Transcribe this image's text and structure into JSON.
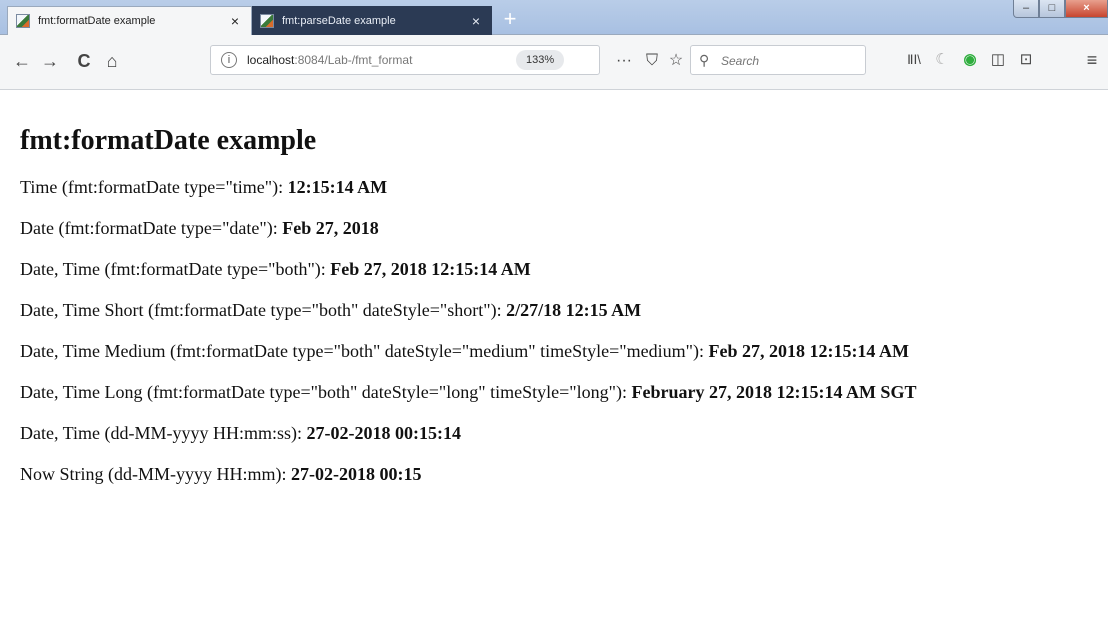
{
  "browser": {
    "tabs": [
      {
        "title": "fmt:formatDate example",
        "close": "×",
        "active": true
      },
      {
        "title": "fmt:parseDate example",
        "close": "×",
        "active": false
      }
    ],
    "new_tab": "+",
    "window_controls": {
      "minimize": "–",
      "maximize": "□",
      "close": "×"
    },
    "nav": {
      "back": "←",
      "forward": "→",
      "reload": "C",
      "home": "⌂"
    },
    "url": {
      "host": "localhost",
      "rest": ":8084/Lab-/fmt_format",
      "zoom": "133%",
      "page_actions": "···",
      "pocket": "⛉",
      "bookmark": "☆"
    },
    "search": {
      "placeholder": "Search",
      "icon": "search-icon"
    },
    "toolbar": {
      "library": "ⅡⅠ\\",
      "reader": "☾",
      "extension": "◉",
      "sidebar": "◫",
      "screenshot": "⊡",
      "menu": "≡"
    }
  },
  "page": {
    "title": "fmt:formatDate example",
    "lines": [
      {
        "label": "Time (fmt:formatDate type=\"time\"): ",
        "value": "12:15:14 AM"
      },
      {
        "label": "Date (fmt:formatDate type=\"date\"): ",
        "value": "Feb 27, 2018"
      },
      {
        "label": "Date, Time (fmt:formatDate type=\"both\"): ",
        "value": "Feb 27, 2018 12:15:14 AM"
      },
      {
        "label": "Date, Time Short (fmt:formatDate type=\"both\" dateStyle=\"short\"): ",
        "value": "2/27/18 12:15 AM"
      },
      {
        "label": "Date, Time Medium (fmt:formatDate type=\"both\" dateStyle=\"medium\" timeStyle=\"medium\"): ",
        "value": "Feb 27, 2018 12:15:14 AM"
      },
      {
        "label": "Date, Time Long (fmt:formatDate type=\"both\" dateStyle=\"long\" timeStyle=\"long\"): ",
        "value": "February 27, 2018 12:15:14 AM SGT"
      },
      {
        "label": "Date, Time (dd-MM-yyyy HH:mm:ss): ",
        "value": "27-02-2018 00:15:14"
      },
      {
        "label": "Now String (dd-MM-yyyy HH:mm): ",
        "value": "27-02-2018 00:15"
      }
    ]
  }
}
